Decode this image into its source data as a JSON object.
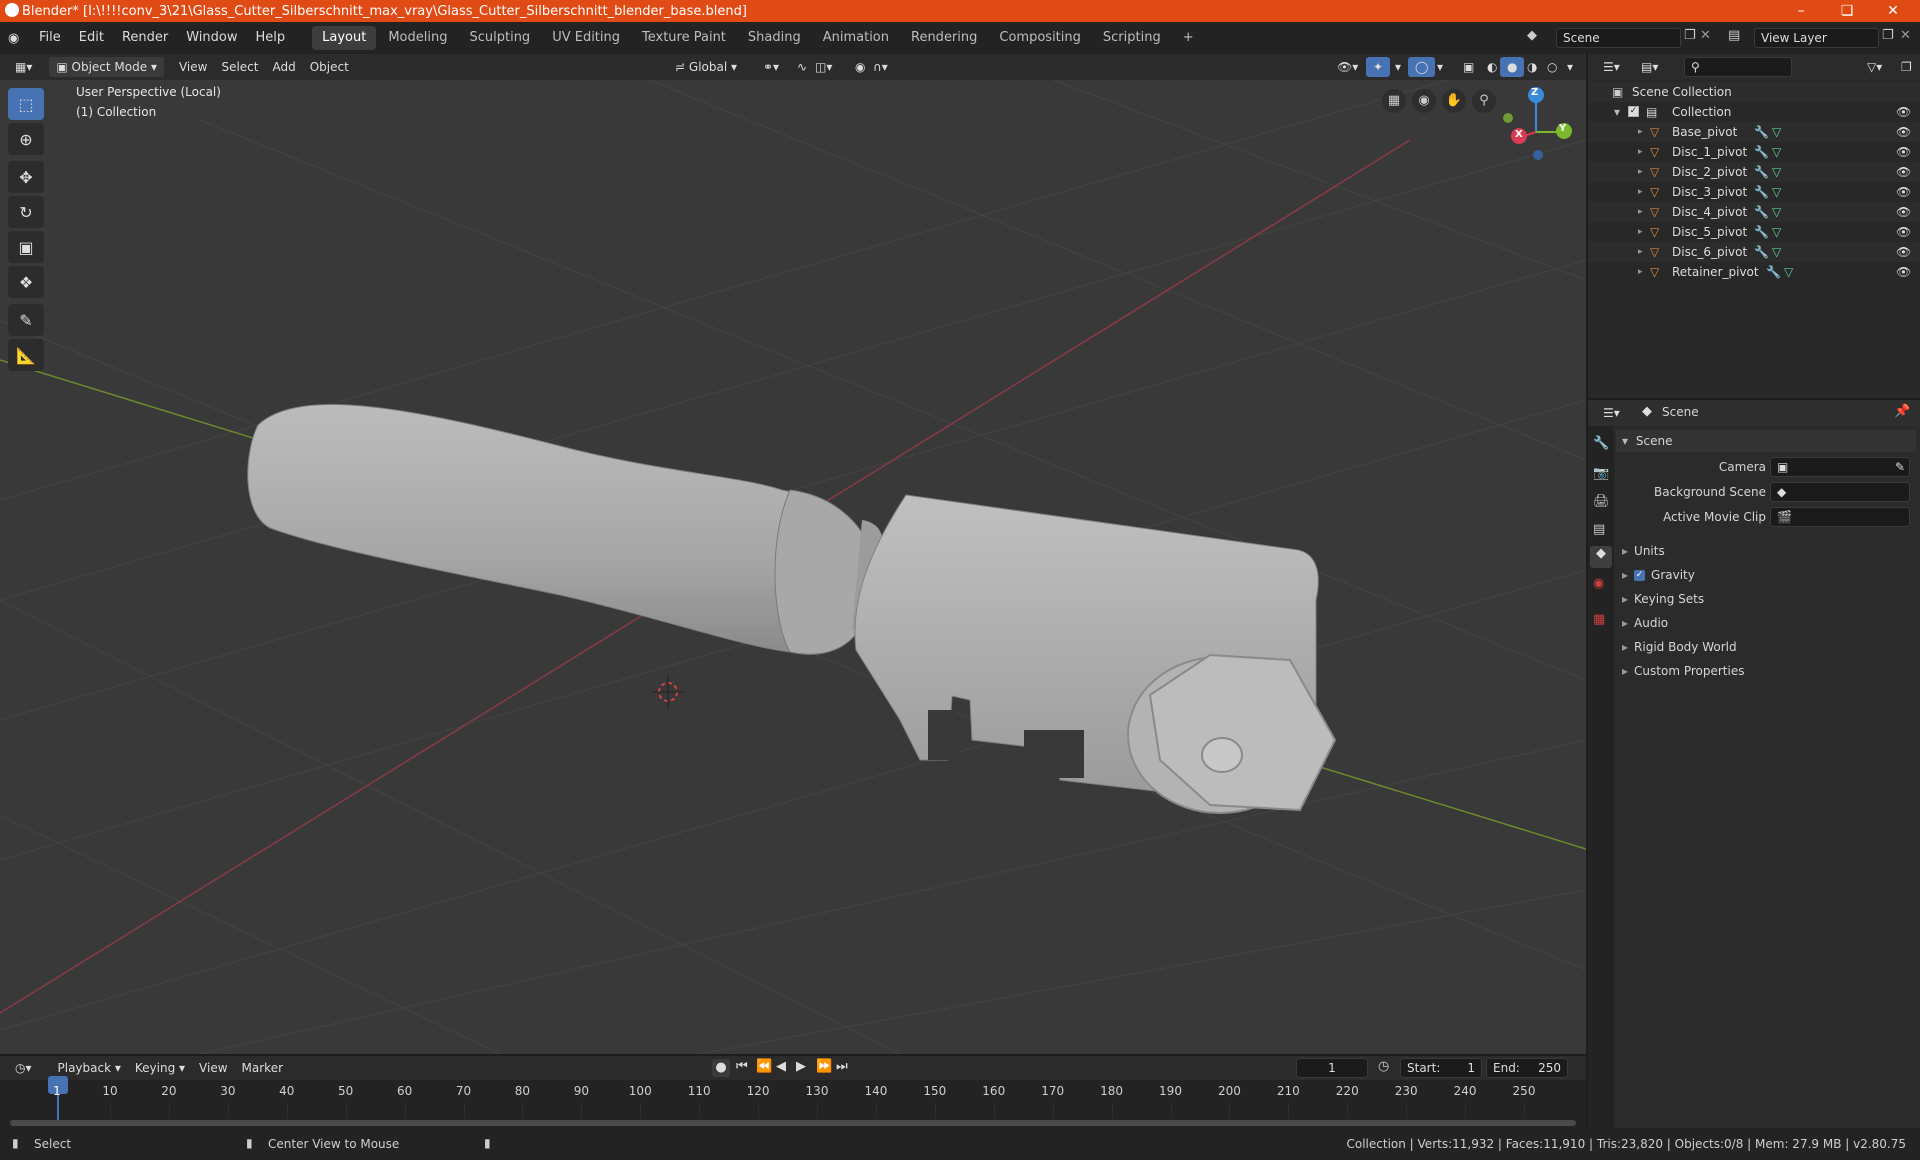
{
  "window": {
    "title": "Blender* [I:\\!!!!conv_3\\21\\Glass_Cutter_Silberschnitt_max_vray\\Glass_Cutter_Silberschnitt_blender_base.blend]"
  },
  "topbar": {
    "menus": [
      "File",
      "Edit",
      "Render",
      "Window",
      "Help"
    ],
    "workspaces": [
      "Layout",
      "Modeling",
      "Sculpting",
      "UV Editing",
      "Texture Paint",
      "Shading",
      "Animation",
      "Rendering",
      "Compositing",
      "Scripting"
    ],
    "active_workspace": "Layout",
    "scene": "Scene",
    "view_layer": "View Layer"
  },
  "viewport_header": {
    "mode": "Object Mode",
    "menus": [
      "View",
      "Select",
      "Add",
      "Object"
    ],
    "orientation": "Global"
  },
  "viewport": {
    "perspective_label": "User Perspective (Local)",
    "collection_label": "(1) Collection",
    "gizmo_axes": [
      "Z",
      "Y",
      "X"
    ]
  },
  "outliner": {
    "root": "Scene Collection",
    "collection": "Collection",
    "objects": [
      "Base_pivot",
      "Disc_1_pivot",
      "Disc_2_pivot",
      "Disc_3_pivot",
      "Disc_4_pivot",
      "Disc_5_pivot",
      "Disc_6_pivot",
      "Retainer_pivot"
    ]
  },
  "properties": {
    "context": "Scene",
    "panel_title": "Scene",
    "camera_label": "Camera",
    "background_scene_label": "Background Scene",
    "active_movie_clip_label": "Active Movie Clip",
    "sections": [
      "Units",
      "Gravity",
      "Keying Sets",
      "Audio",
      "Rigid Body World",
      "Custom Properties"
    ],
    "gravity_checked": true
  },
  "timeline": {
    "menus": [
      "Playback",
      "Keying",
      "View",
      "Marker"
    ],
    "current_frame": "1",
    "start_label": "Start:",
    "start": "1",
    "end_label": "End:",
    "end": "250",
    "ticks": [
      "1",
      "10",
      "20",
      "30",
      "40",
      "50",
      "60",
      "70",
      "80",
      "90",
      "100",
      "110",
      "120",
      "130",
      "140",
      "150",
      "160",
      "170",
      "180",
      "190",
      "200",
      "210",
      "220",
      "230",
      "240",
      "250"
    ]
  },
  "statusbar": {
    "select": "Select",
    "center_view": "Center View to Mouse",
    "stats": "Collection | Verts:11,932 | Faces:11,910 | Tris:23,820 | Objects:0/8 | Mem: 27.9 MB | v2.80.75"
  },
  "colors": {
    "titlebar": "#e04a14",
    "accent": "#4772b3",
    "object_orange": "#e8893a",
    "modifier_blue": "#6fa7e8",
    "mesh_green": "#5fd0a0"
  }
}
